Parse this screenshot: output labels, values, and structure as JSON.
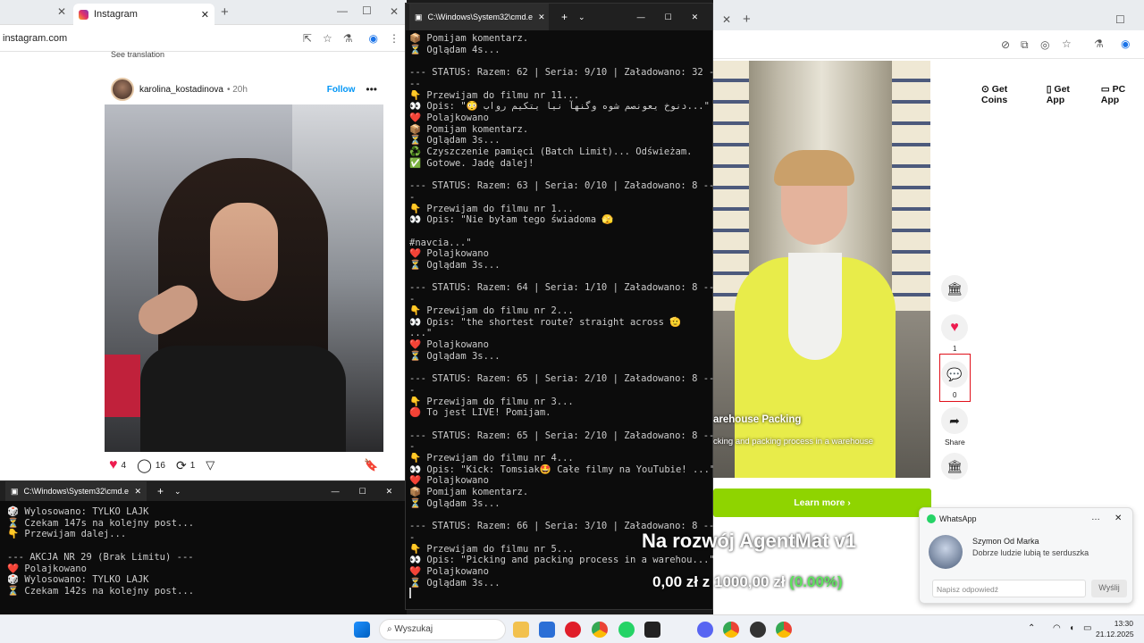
{
  "left_browser": {
    "tab_title": "Instagram",
    "url": "instagram.com",
    "see_translation": "See translation",
    "username": "karolina_kostadinova",
    "time": "• 20h",
    "follow": "Follow",
    "likes": "4",
    "comments": "16",
    "shares": "1"
  },
  "cmd_main": {
    "title": "C:\\Windows\\System32\\cmd.e",
    "lines": [
      "📦 Pomijam komentarz.",
      "⏳ Oglądam 4s...",
      "",
      "--- STATUS: Razem: 62 | Seria: 9/10 | Załadowano: 32 -",
      "--",
      "👇 Przewijam do filmu nr 11...",
      "👀 Opis: \"😳 دنوخ يعونصم شوه وگنهآ نیا یتکیم رواب...\"",
      "❤️ Polajkowano",
      "📦 Pomijam komentarz.",
      "⏳ Oglądam 3s...",
      "♻️ Czyszczenie pamięci (Batch Limit)... Odświeżam.",
      "✅ Gotowe. Jadę dalej!",
      "",
      "--- STATUS: Razem: 63 | Seria: 0/10 | Załadowano: 8 --",
      "-",
      "👇 Przewijam do filmu nr 1...",
      "👀 Opis: \"Nie byłam tego świadoma 🫣",
      "",
      "#navcia...\"",
      "❤️ Polajkowano",
      "⏳ Oglądam 3s...",
      "",
      "--- STATUS: Razem: 64 | Seria: 1/10 | Załadowano: 8 --",
      "-",
      "👇 Przewijam do filmu nr 2...",
      "👀 Opis: \"the shortest route? straight across 🫡",
      "...\"",
      "❤️ Polajkowano",
      "⏳ Oglądam 3s...",
      "",
      "--- STATUS: Razem: 65 | Seria: 2/10 | Załadowano: 8 --",
      "-",
      "👇 Przewijam do filmu nr 3...",
      "🔴 To jest LIVE! Pomijam.",
      "",
      "--- STATUS: Razem: 65 | Seria: 2/10 | Załadowano: 8 --",
      "-",
      "👇 Przewijam do filmu nr 4...",
      "👀 Opis: \"Kick: Tomsiak🤩 Całe filmy na YouTubie! ...\"",
      "❤️ Polajkowano",
      "📦 Pomijam komentarz.",
      "⏳ Oglądam 3s...",
      "",
      "--- STATUS: Razem: 66 | Seria: 3/10 | Załadowano: 8 --",
      "-",
      "👇 Przewijam do filmu nr 5...",
      "👀 Opis: \"Picking and packing process in a warehou...\"",
      "❤️ Polajkowano",
      "⏳ Oglądam 3s..."
    ]
  },
  "cmd_small": {
    "title": "C:\\Windows\\System32\\cmd.e",
    "lines": [
      "🎲 Wylosowano: TYLKO LAJK",
      "⏳ Czekam 147s na kolejny post...",
      "👇 Przewijam dalej...",
      "",
      "--- AKCJA NR 29 (Brak Limitu) ---",
      "❤️ Polajkowano",
      "🎲 Wylosowano: TYLKO LAJK",
      "⏳ Czekam 142s na kolejny post..."
    ]
  },
  "right_browser": {
    "get_coins": "Get Coins",
    "get_app": "Get App",
    "pc_app": "PC App",
    "video_title": "arehouse Packing",
    "video_desc": "cking and packing process in a warehouse",
    "like_count": "1",
    "comment_count": "0",
    "share_label": "Share",
    "learn_more": "Learn more"
  },
  "whatsapp": {
    "app": "WhatsApp",
    "sender": "Szymon Od Marka",
    "message": "Dobrze ludzie lubią te serduszka",
    "placeholder": "Napisz odpowiedź",
    "send": "Wyślij"
  },
  "overlay": {
    "title": "Na rozwój AgentMat v1",
    "amount": "0,00 zł",
    "of": "z",
    "goal": "1000,00 zł",
    "percent": "(0.00%)"
  },
  "taskbar": {
    "search": "Wyszukaj",
    "time": "13:30",
    "date": "21.12.2025"
  },
  "colors": {
    "accent_green": "#8fd400",
    "ig_blue": "#0095f6",
    "percent_green": "#5ee35e"
  }
}
